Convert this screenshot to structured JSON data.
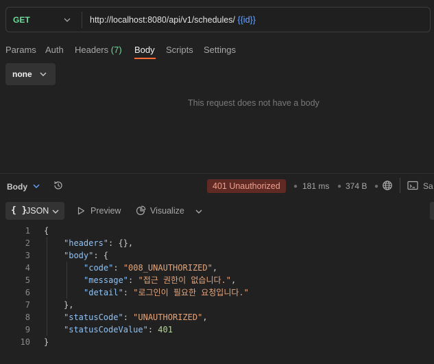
{
  "request": {
    "method": "GET",
    "url_base": "http://localhost:8080/api/v1/schedules/",
    "url_var": "{{id}}",
    "tabs": [
      {
        "label": "Params"
      },
      {
        "label": "Auth"
      },
      {
        "label": "Headers",
        "count": "(7)"
      },
      {
        "label": "Body"
      },
      {
        "label": "Scripts"
      },
      {
        "label": "Settings"
      }
    ],
    "active_tab": "Body",
    "body_type": "none",
    "empty_message": "This request does not have a body"
  },
  "response": {
    "label": "Body",
    "status": "401 Unauthorized",
    "time": "181 ms",
    "size": "374 B",
    "save_label": "Sa",
    "format": "JSON",
    "format_icon": "{ }",
    "preview_label": "Preview",
    "visualize_label": "Visualize",
    "lines": [
      {
        "num": "1",
        "indent": 0,
        "tokens": [
          [
            "p",
            "{"
          ]
        ]
      },
      {
        "num": "2",
        "indent": 1,
        "tokens": [
          [
            "k",
            "\"headers\""
          ],
          [
            "p",
            ": {},"
          ]
        ]
      },
      {
        "num": "3",
        "indent": 1,
        "tokens": [
          [
            "k",
            "\"body\""
          ],
          [
            "p",
            ": {"
          ]
        ]
      },
      {
        "num": "4",
        "indent": 2,
        "tokens": [
          [
            "k",
            "\"code\""
          ],
          [
            "p",
            ": "
          ],
          [
            "s",
            "\"008_UNAUTHORIZED\""
          ],
          [
            "p",
            ","
          ]
        ]
      },
      {
        "num": "5",
        "indent": 2,
        "tokens": [
          [
            "k",
            "\"message\""
          ],
          [
            "p",
            ": "
          ],
          [
            "s",
            "\"접근 권한이 없습니다.\""
          ],
          [
            "p",
            ","
          ]
        ]
      },
      {
        "num": "6",
        "indent": 2,
        "tokens": [
          [
            "k",
            "\"detail\""
          ],
          [
            "p",
            ": "
          ],
          [
            "s",
            "\"로그인이 필요한 요청입니다.\""
          ]
        ]
      },
      {
        "num": "7",
        "indent": 1,
        "tokens": [
          [
            "p",
            "},"
          ]
        ]
      },
      {
        "num": "8",
        "indent": 1,
        "tokens": [
          [
            "k",
            "\"statusCode\""
          ],
          [
            "p",
            ": "
          ],
          [
            "s",
            "\"UNAUTHORIZED\""
          ],
          [
            "p",
            ","
          ]
        ]
      },
      {
        "num": "9",
        "indent": 1,
        "tokens": [
          [
            "k",
            "\"statusCodeValue\""
          ],
          [
            "p",
            ": "
          ],
          [
            "n",
            "401"
          ]
        ]
      },
      {
        "num": "10",
        "indent": 0,
        "tokens": [
          [
            "p",
            "}"
          ]
        ]
      }
    ]
  },
  "colors": {
    "background": "#212121",
    "method_get": "#6bdd9a",
    "accent": "#ff6c37",
    "status_error_bg": "#5e2a23",
    "json_key": "#8fc2f5",
    "json_string": "#e6a57a",
    "json_number": "#b5d59a"
  },
  "icons": [
    "chevron-down-icon",
    "history-icon",
    "globe-icon",
    "save-icon",
    "play-icon",
    "visualize-icon"
  ]
}
